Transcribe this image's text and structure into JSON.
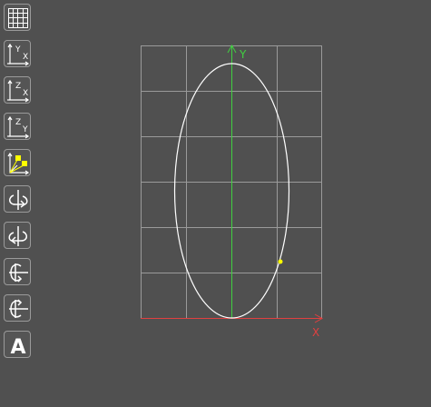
{
  "toolbar": {
    "tools": [
      {
        "name": "grid-toggle",
        "icon": "grid-icon"
      },
      {
        "name": "view-xy",
        "icon": "axes-xy-icon",
        "upper": "Y",
        "lower": "X"
      },
      {
        "name": "view-zx",
        "icon": "axes-zx-icon",
        "upper": "Z",
        "lower": "X"
      },
      {
        "name": "view-zy",
        "icon": "axes-zy-icon",
        "upper": "Z",
        "lower": "Y"
      },
      {
        "name": "view-3d",
        "icon": "axes-3d-icon"
      },
      {
        "name": "rotate-around-y",
        "icon": "rotate-y-icon"
      },
      {
        "name": "rotate-around-y-reverse",
        "icon": "rotate-y-reverse-icon"
      },
      {
        "name": "rotate-around-x",
        "icon": "rotate-x-icon"
      },
      {
        "name": "rotate-around-x-reverse",
        "icon": "rotate-x-reverse-icon"
      },
      {
        "name": "text-tool",
        "icon": "text-icon",
        "glyph": "A"
      }
    ]
  },
  "viewport": {
    "x_label": "X",
    "y_label": "Y",
    "colors": {
      "background": "#505050",
      "grid": "#9a9a9a",
      "x_axis": "#e04040",
      "y_axis": "#40d040",
      "curve": "#ffffff",
      "handle": "#ffff00"
    }
  }
}
